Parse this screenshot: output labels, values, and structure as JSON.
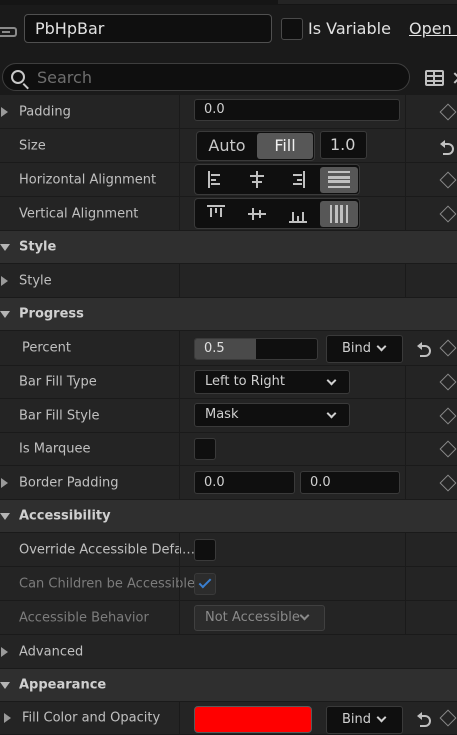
{
  "header": {
    "widget_name": "PbHpBar",
    "is_variable_label": "Is Variable",
    "is_variable_checked": false,
    "open_label": "Open l"
  },
  "search": {
    "placeholder": "Search"
  },
  "padding": {
    "label": "Padding",
    "value": "0.0"
  },
  "size": {
    "label": "Size",
    "options": [
      "Auto",
      "Fill"
    ],
    "selected": "Fill",
    "value": "1.0"
  },
  "horizontal_alignment": {
    "label": "Horizontal Alignment",
    "selected": "fill"
  },
  "vertical_alignment": {
    "label": "Vertical Alignment",
    "selected": "fill"
  },
  "sections": {
    "style": "Style",
    "progress": "Progress",
    "accessibility": "Accessibility",
    "advanced": "Advanced",
    "appearance": "Appearance"
  },
  "style_row": {
    "label": "Style"
  },
  "percent": {
    "label": "Percent",
    "value": "0.5",
    "fill_fraction": 0.5,
    "bind_label": "Bind"
  },
  "bar_fill_type": {
    "label": "Bar Fill Type",
    "value": "Left to Right"
  },
  "bar_fill_style": {
    "label": "Bar Fill Style",
    "value": "Mask"
  },
  "is_marquee": {
    "label": "Is Marquee",
    "checked": false
  },
  "border_padding": {
    "label": "Border Padding",
    "x": "0.0",
    "y": "0.0"
  },
  "override_accessible": {
    "label": "Override Accessible Defa…",
    "checked": false
  },
  "can_children": {
    "label": "Can Children be Accessible",
    "checked": true
  },
  "accessible_behavior": {
    "label": "Accessible Behavior",
    "value": "Not Accessible"
  },
  "fill_color": {
    "label": "Fill Color and Opacity",
    "color": "#ff0000",
    "bind_label": "Bind"
  }
}
